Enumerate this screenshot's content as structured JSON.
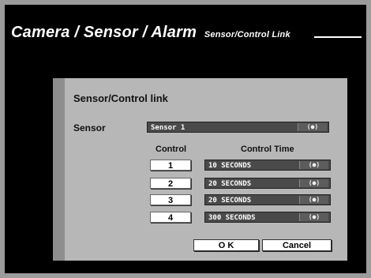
{
  "header": {
    "title": "Camera / Sensor / Alarm",
    "subtitle": "Sensor/Control Link"
  },
  "dialog": {
    "title": "Sensor/Control link",
    "sensor_label": "Sensor",
    "sensor_value": "Sensor 1",
    "select_glyph": "(●)",
    "control_header": "Control",
    "control_time_header": "Control Time",
    "rows": [
      {
        "control": "1",
        "time": "10 SECONDS"
      },
      {
        "control": "2",
        "time": "20 SECONDS"
      },
      {
        "control": "3",
        "time": "20 SECONDS"
      },
      {
        "control": "4",
        "time": "300 SECONDS"
      }
    ],
    "ok_label": "O K",
    "cancel_label": "Cancel"
  },
  "colors": {
    "screen_bg": "#000000",
    "dialog_bg": "#b7b7b7",
    "select_bg": "#4a4a4a"
  }
}
